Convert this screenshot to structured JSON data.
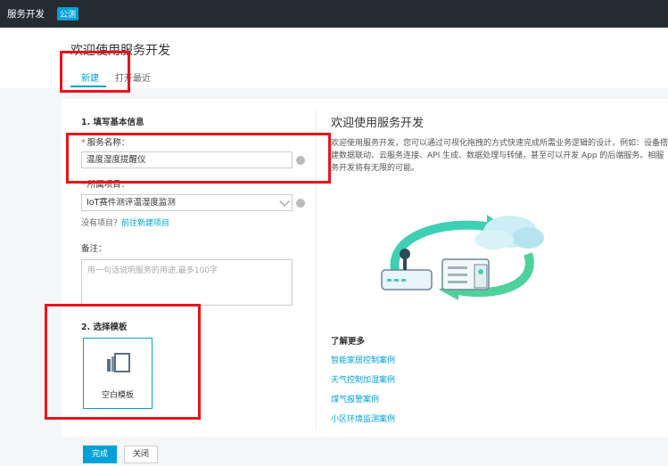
{
  "topbar": {
    "brand": "服务开发",
    "tag": "公测"
  },
  "header": {
    "title": "欢迎使用服务开发",
    "tabs": [
      {
        "label": "新建"
      },
      {
        "label": "打开最近"
      }
    ]
  },
  "form": {
    "section1_title": "1. 填写基本信息",
    "service_name_label": "服务名称：",
    "service_name_value": "温度湿度提醒仪",
    "project_label": "所属项目：",
    "project_value": "IoT赛件测评温湿度监测",
    "no_project_hint": "没有项目？",
    "new_project_link": "前往新建项目",
    "remark_label": "备注：",
    "remark_placeholder": "用一句话说明服务的用途,最多100字",
    "section2_title": "2. 选择模板",
    "template_label": "空白模板"
  },
  "right": {
    "title": "欢迎使用服务开发",
    "description": "欢迎使用服务开发，您可以通过可视化拖拽的方式快速完成所需业务逻辑的设计，例如：设备搭建数据联动、云服务连接、API 生成、数据处理与转储，甚至可以开发 App 的后端服务。相服务开发将有无限的可能。",
    "learn_more": "了解更多",
    "links": [
      {
        "label": "智能家居控制案例"
      },
      {
        "label": "天气控制加湿案例"
      },
      {
        "label": "煤气报警案例"
      },
      {
        "label": "小区环境监测案例"
      }
    ]
  },
  "footer": {
    "done_label": "完成",
    "close_label": "关闭"
  },
  "colors": {
    "accent": "#00a1d6",
    "annotation": "#e8141c",
    "topbar": "#262a31"
  }
}
